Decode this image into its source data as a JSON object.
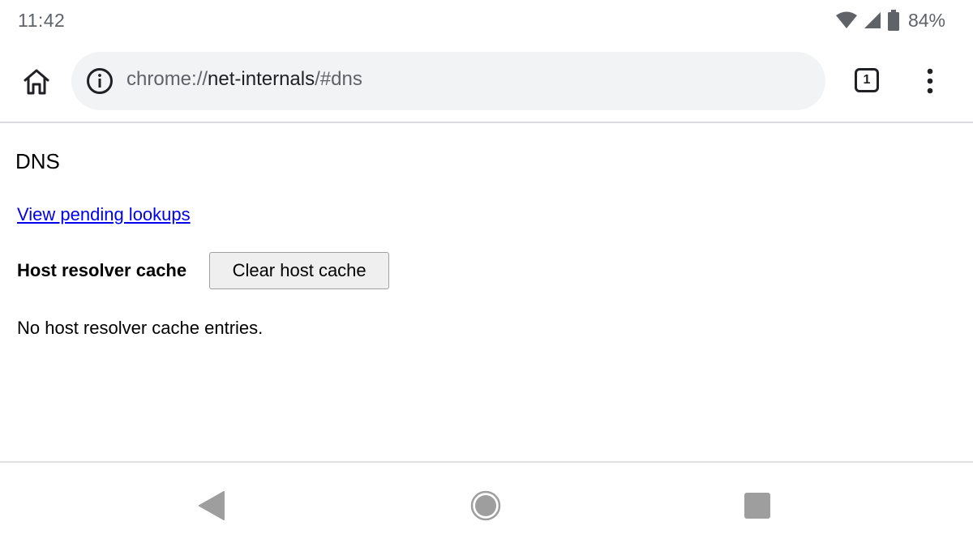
{
  "status_bar": {
    "time": "11:42",
    "battery_percent": "84%",
    "icons": [
      "wifi-icon",
      "cell-signal-icon",
      "battery-icon"
    ]
  },
  "toolbar": {
    "url_scheme": "chrome://",
    "url_host": "net-internals",
    "url_rest": "/#dns",
    "tab_count": "1",
    "icons": [
      "home-icon",
      "info-icon",
      "tab-switcher-icon",
      "more-vert-icon"
    ]
  },
  "page": {
    "title": "DNS",
    "pending_link": "View pending lookups",
    "cache_label": "Host resolver cache",
    "clear_button": "Clear host cache",
    "empty_message": "No host resolver cache entries."
  },
  "nav_bar": {
    "icons": [
      "back-icon",
      "home-circle-icon",
      "recents-icon"
    ]
  },
  "colors": {
    "link": "#0000ee",
    "omnibox_bg": "#f1f3f4",
    "icon_gray": "#5f6368",
    "nav_gray": "#9e9e9e"
  }
}
